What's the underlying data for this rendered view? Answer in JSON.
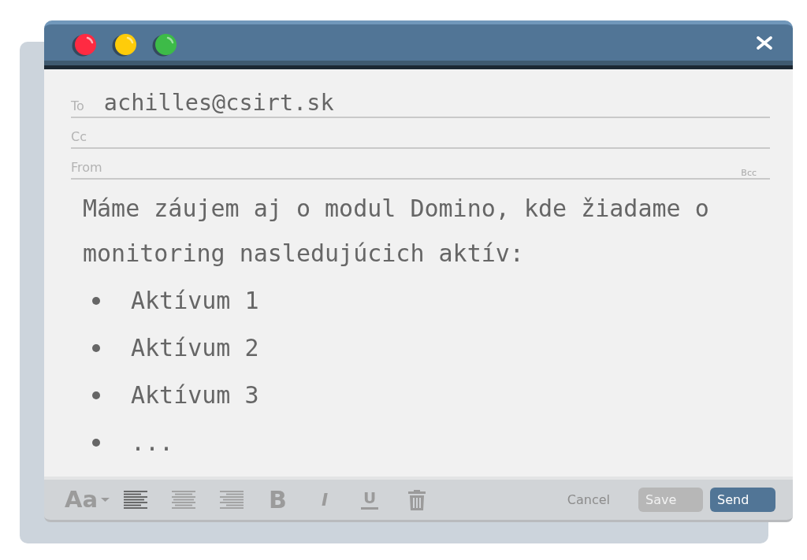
{
  "compose": {
    "fields": [
      {
        "label": "To",
        "value": "achilles@csirt.sk"
      },
      {
        "label": "Cc"
      },
      {
        "label": "From",
        "link": "Bcc"
      }
    ],
    "message": {
      "paragraph": "Máme záujem aj o modul Domino, kde žiadame o monitoring nasledujúcich aktív:",
      "bullets": [
        "Aktívum 1",
        "Aktívum 2",
        "Aktívum 3",
        "..."
      ]
    }
  },
  "toolbar": {
    "font_button": "Aa",
    "alignments": [
      {
        "kind": "left",
        "selected": true
      },
      {
        "kind": "center",
        "selected": false
      },
      {
        "kind": "right",
        "selected": false
      }
    ],
    "format_buttons": [
      {
        "kind": "bold",
        "label": "B"
      },
      {
        "kind": "italic",
        "label": "I"
      },
      {
        "kind": "underline",
        "label": "U"
      }
    ],
    "actions": [
      {
        "kind": "link",
        "label": "Cancel"
      },
      {
        "kind": "secondary",
        "label": "Save"
      },
      {
        "kind": "primary",
        "label": "Send"
      }
    ]
  }
}
